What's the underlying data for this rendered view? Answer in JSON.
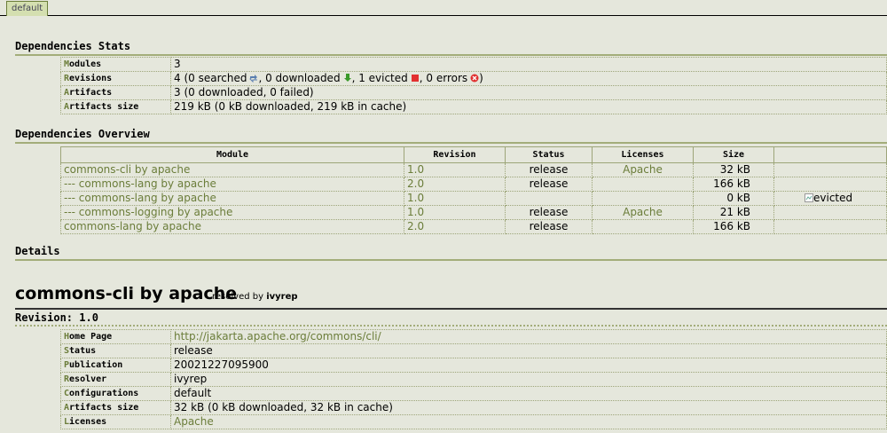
{
  "tab": {
    "label": "default"
  },
  "sections": {
    "stats": "Dependencies Stats",
    "overview": "Dependencies Overview",
    "details": "Details"
  },
  "stats": {
    "modules": {
      "key_first": "M",
      "key_rest": "odules",
      "value": "3"
    },
    "revisions": {
      "key_first": "R",
      "key_rest": "evisions",
      "v1": "4 (0 searched",
      "v2": ", 0 downloaded",
      "v3": ", 1 evicted",
      "v4": ", 0 errors",
      "v5": ")"
    },
    "artifacts": {
      "key_first": "A",
      "key_rest": "rtifacts",
      "value": "3 (0 downloaded, 0 failed)"
    },
    "artifacts_size": {
      "key_first": "A",
      "key_rest": "rtifacts size",
      "value": "219 kB (0 kB downloaded, 219 kB in cache)"
    }
  },
  "overview": {
    "headers": [
      "Module",
      "Revision",
      "Status",
      "Licenses",
      "Size",
      ""
    ],
    "rows": [
      {
        "module": "commons-cli by apache",
        "revision": "1.0",
        "status": "release",
        "license": "Apache",
        "size": "32 kB",
        "extra": ""
      },
      {
        "module": "--- commons-lang by apache",
        "revision": "2.0",
        "status": "release",
        "license": "",
        "size": "166 kB",
        "extra": ""
      },
      {
        "module": "--- commons-lang by apache",
        "revision": "1.0",
        "status": "",
        "license": "",
        "size": "0 kB",
        "extra": "evicted"
      },
      {
        "module": "--- commons-logging by apache",
        "revision": "1.0",
        "status": "release",
        "license": "Apache",
        "size": "21 kB",
        "extra": ""
      },
      {
        "module": "commons-lang by apache",
        "revision": "2.0",
        "status": "release",
        "license": "",
        "size": "166 kB",
        "extra": ""
      }
    ]
  },
  "details": {
    "title": "commons-cli by apache",
    "resolved_label": "resolved by",
    "resolver_name": "ivyrep",
    "revision_line": "Revision: 1.0",
    "fields": [
      {
        "kf": "H",
        "kr": "ome Page",
        "value": "http://jakarta.apache.org/commons/cli/",
        "link": true
      },
      {
        "kf": "S",
        "kr": "tatus",
        "value": "release",
        "link": false
      },
      {
        "kf": "P",
        "kr": "ublication",
        "value": "20021227095900",
        "link": false
      },
      {
        "kf": "R",
        "kr": "esolver",
        "value": "ivyrep",
        "link": false
      },
      {
        "kf": "C",
        "kr": "onfigurations",
        "value": "default",
        "link": false
      },
      {
        "kf": "A",
        "kr": "rtifacts size",
        "value": "32 kB (0 kB downloaded, 32 kB in cache)",
        "link": false
      },
      {
        "kf": "L",
        "kr": "icenses",
        "value": "Apache",
        "link": true
      }
    ]
  },
  "colors": {
    "accent": "#6b7d3a",
    "background": "#e5e7dc"
  },
  "icons": [
    "searched-icon",
    "downloaded-icon",
    "evicted-icon",
    "error-icon"
  ]
}
